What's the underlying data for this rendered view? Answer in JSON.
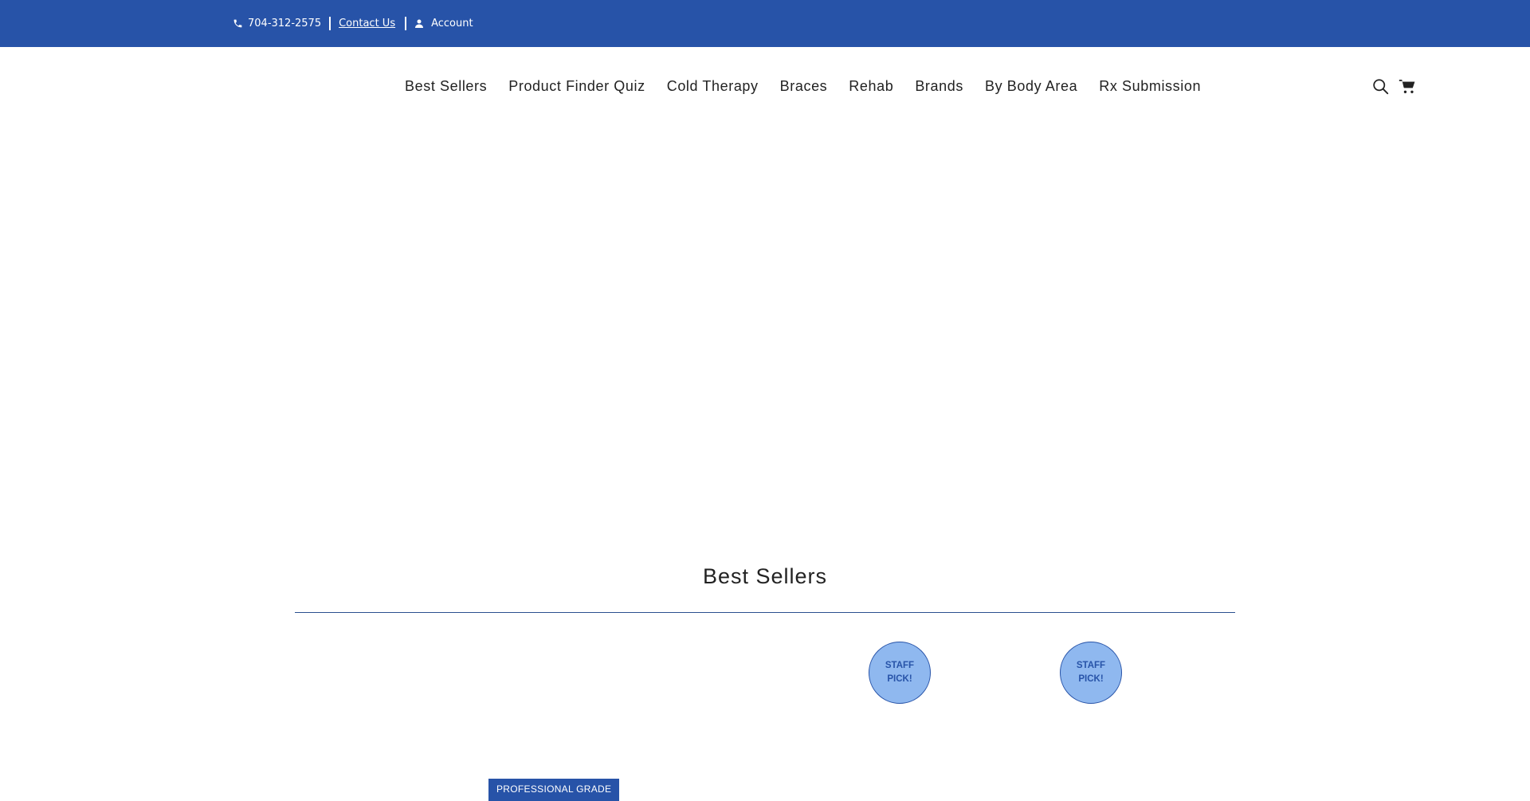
{
  "topbar": {
    "background": "#2753a8",
    "phone": "704-312-2575",
    "contact_label": "Contact Us",
    "account_label": "Account"
  },
  "nav": {
    "items": [
      {
        "label": "Best Sellers"
      },
      {
        "label": "Product Finder Quiz"
      },
      {
        "label": "Cold Therapy"
      },
      {
        "label": "Braces"
      },
      {
        "label": "Rehab"
      },
      {
        "label": "Brands"
      },
      {
        "label": "By Body Area"
      },
      {
        "label": "Rx Submission"
      }
    ],
    "icons": [
      "search-icon",
      "cart-icon"
    ]
  },
  "best_sellers": {
    "title": "Best Sellers",
    "badges": [
      {
        "label": "STAFF PICK!"
      },
      {
        "label": "STAFF PICK!"
      }
    ],
    "tags": [
      {
        "label": "PROFESSIONAL GRADE"
      }
    ],
    "accent": "#2753a8",
    "badge_fill": "#8fb8ef"
  }
}
